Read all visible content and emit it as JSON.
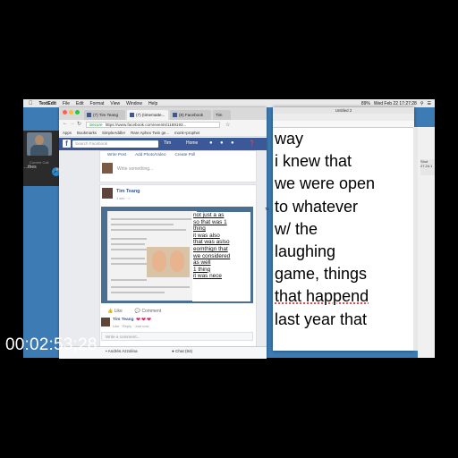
{
  "menubar": {
    "app_name": "TextEdit",
    "items": [
      "File",
      "Edit",
      "Format",
      "View",
      "Window",
      "Help"
    ],
    "clock": "Wed Feb 22  17:27:28",
    "battery": "89%"
  },
  "call": {
    "status": "Current Call",
    "name": "...thes"
  },
  "browser": {
    "tabs": [
      "(7) Tim Teang",
      "(7) (timematte...",
      "(8) Facebook",
      "Tim"
    ],
    "secure_label": "Secure",
    "url": "https://www.facebook.com/events/1189193...",
    "bookmarks": [
      "Apps",
      "Bookmarks",
      "SimpleAddler",
      "Rare Aphex Twin ge...",
      "monk+prophet"
    ]
  },
  "facebook": {
    "logo": "f",
    "search_placeholder": "Search Facebook",
    "user_name": "Tim",
    "home_label": "Home",
    "composer": {
      "tabs": [
        "Write Post",
        "Add Photo/Video",
        "Create Poll"
      ],
      "placeholder": "Write something..."
    },
    "post": {
      "author": "Tim Teang",
      "meta": "1 sec · ⌂",
      "image_text_lines": [
        "not just a as",
        "so that was 1",
        "thing",
        "it was also",
        "that was aslso",
        "eomthign that",
        "we considered",
        "as well",
        "1 thing",
        "it was nece"
      ],
      "actions": [
        "Like",
        "Comment"
      ]
    },
    "comment": {
      "author": "Tim Teang",
      "hearts": "❤❤❤",
      "links": "Like · Reply · Just now",
      "placeholder": "Write a comment..."
    },
    "chat": {
      "user": "• Andrés Azzolina",
      "label": "● Chat (84)"
    }
  },
  "textedit": {
    "title": "Untitled 2",
    "lines": [
      "way",
      "i knew that",
      "we were open",
      "to whatever",
      "w/ the",
      "laughing",
      "game, things",
      "that happend",
      "last year that"
    ]
  },
  "side_label": "To",
  "right_thumb": "Shot\n27.24.1",
  "timecode": "00:02:53;28"
}
